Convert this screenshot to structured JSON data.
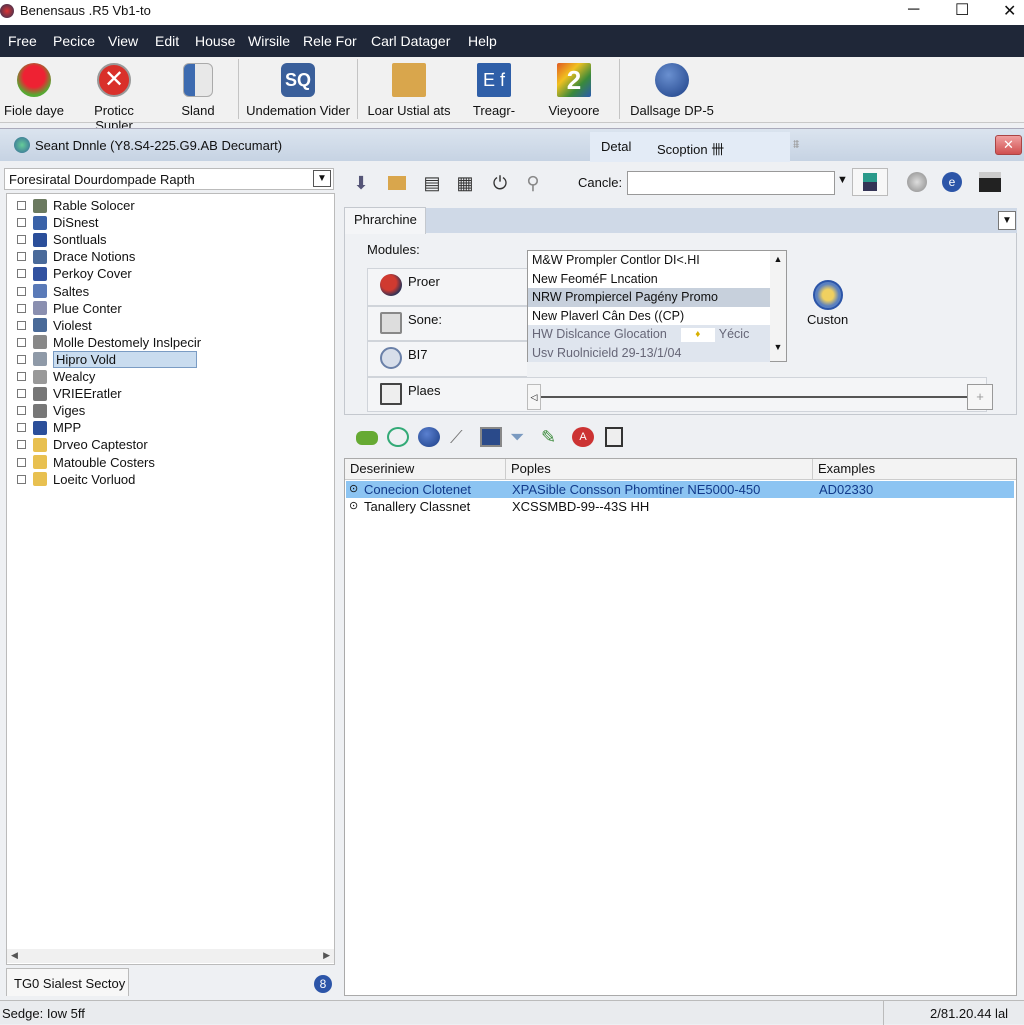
{
  "window": {
    "title": "Benensaus .R5 Vb1-to",
    "controls": [
      "─",
      "☐",
      "✕"
    ]
  },
  "menu": [
    "Free",
    "Pecice",
    "View",
    "Edit",
    "House",
    "Wirsile",
    "Rele For",
    "Carl Datager",
    "Help"
  ],
  "toolbar": [
    {
      "label": "Fiole daye",
      "icon": "flower-icon",
      "color": "#d23a2a"
    },
    {
      "label": "Proticc Supler",
      "icon": "error-circle-icon",
      "color": "#d9302a"
    },
    {
      "label": "Sland",
      "icon": "document-stack-icon",
      "color": "#5a7fb0"
    },
    {
      "label": "Undemation Vider",
      "icon": "sql-magnifier-icon",
      "color": "#3a5f9a"
    },
    {
      "label": "Loar Ustial ats",
      "icon": "folder-icon",
      "color": "#d9a64c"
    },
    {
      "label": "Treagr-",
      "icon": "ef-icon",
      "color": "#2f5fa8"
    },
    {
      "label": "Vieyoore",
      "icon": "number-2-icon",
      "color": "#e05a22"
    },
    {
      "label": "Dallsage DP-5",
      "icon": "globe-icon",
      "color": "#27509a"
    }
  ],
  "docbar": {
    "title": "Seant Dnnle (Y8.S4-225.G9.AB Decumart)",
    "tabs": [
      "Detal",
      "Scoption 卌"
    ],
    "close": "✕"
  },
  "left": {
    "dropdown": "Foresiratal Dourdompade Rapth",
    "items": [
      {
        "label": "Rable Solocer",
        "color": "#6b7a60"
      },
      {
        "label": "DiSnest",
        "color": "#3a62a8"
      },
      {
        "label": "Sontluals",
        "color": "#2b4f9a"
      },
      {
        "label": "Drace Notions",
        "color": "#4a6a9a"
      },
      {
        "label": "Perkoy Cover",
        "color": "#3252a0"
      },
      {
        "label": "Saltes",
        "color": "#5a7ab8"
      },
      {
        "label": "Plue Conter",
        "color": "#8a8fb0"
      },
      {
        "label": "Violest",
        "color": "#4a6a98"
      },
      {
        "label": "Molle Destomely Inslpecir",
        "color": "#888"
      },
      {
        "label": "Hipro Vold",
        "color": "#8f9aa8",
        "selected": true
      },
      {
        "label": "Wealcy",
        "color": "#999"
      },
      {
        "label": "VRIEEratler",
        "color": "#777"
      },
      {
        "label": "Viges",
        "color": "#777"
      },
      {
        "label": "MPP",
        "color": "#2b4f9a"
      },
      {
        "label": "Drveo Captestor",
        "color": "#e8c050"
      },
      {
        "label": "Matouble Costers",
        "color": "#e8c050"
      },
      {
        "label": "Loeitc Vorluod",
        "color": "#e8c050"
      }
    ],
    "bottom_tab": "TG0 Sialest Sectoy"
  },
  "right_toolbar": {
    "icons": [
      "install-icon",
      "folder-icon",
      "printer-icon",
      "grid-icon",
      "power-icon",
      "search-icon"
    ],
    "search_label": "Cancle:",
    "search_value": "",
    "right_icons": [
      "settings-icon",
      "ie-icon",
      "print-icon"
    ]
  },
  "panel": {
    "tab": "Phrarchine",
    "modules_label": "Modules:",
    "modules": [
      {
        "label": "Proer",
        "color": "#d03a30"
      },
      {
        "label": "Sone:",
        "color": "#888"
      },
      {
        "label": "BI7",
        "color": "#6a80a8"
      },
      {
        "label": "Plaes",
        "color": "#555"
      }
    ],
    "list": [
      "M&W Prompler Contlor DI<.HI",
      "New FeoméF Lncation",
      "NRW Prompiercel Pagény Promo",
      "New Plaverl Cân Des ((CP)",
      "HW Dislcance Glocation",
      "Usv Ruolnicield 29-13/1/04"
    ],
    "list_selected": 2,
    "list_extra": "Yécic",
    "custom_label": "Custon"
  },
  "icon_row": [
    "leaf-icon",
    "recycle-icon",
    "globe-icon",
    "pen-icon",
    "monitor-icon",
    "funnel-icon",
    "feather-icon",
    "acrobat-icon",
    "notepad-icon"
  ],
  "table": {
    "columns": [
      "Deseriniew",
      "Poples",
      "Examples"
    ],
    "rows": [
      {
        "c1": "Conecion Clotenet",
        "c2": "XPASible Consson Phomtiner NE5000-450",
        "c3": "AD02330",
        "selected": true
      },
      {
        "c1": "Tanallery Classnet",
        "c2": "XCSSMBD-99--43S HH",
        "c3": ""
      }
    ]
  },
  "status": {
    "left": "Sedge: Iow 5ff",
    "right": "2/81.20.44 lal"
  }
}
